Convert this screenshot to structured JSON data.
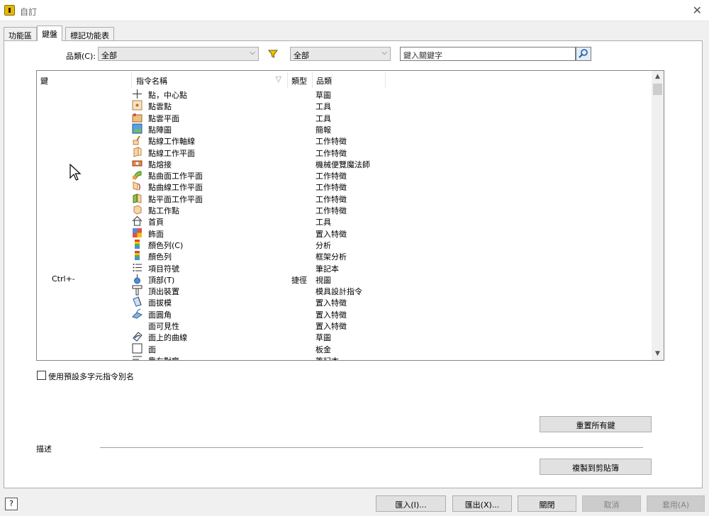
{
  "window": {
    "title": "自訂"
  },
  "tabs": [
    {
      "label": "功能區"
    },
    {
      "label": "鍵盤"
    },
    {
      "label": "標記功能表"
    }
  ],
  "filter": {
    "category_label": "品類(C):",
    "category_value": "全部",
    "type_value": "全部",
    "search_placeholder": "鍵入關鍵字"
  },
  "grid": {
    "headers": {
      "key": "鍵",
      "name": "指令名稱",
      "type": "類型",
      "category": "品類"
    },
    "rows": [
      {
        "key": "",
        "name": "點，中心點",
        "type": "",
        "category": "草圖",
        "icon": "center-point-icon"
      },
      {
        "key": "",
        "name": "點雲點",
        "type": "",
        "category": "工具",
        "icon": "point-cloud-point-icon"
      },
      {
        "key": "",
        "name": "點雲平面",
        "type": "",
        "category": "工具",
        "icon": "point-cloud-plane-icon"
      },
      {
        "key": "",
        "name": "點陣圖",
        "type": "",
        "category": "簡報",
        "icon": "bitmap-icon"
      },
      {
        "key": "",
        "name": "點線工作軸線",
        "type": "",
        "category": "工作特徵",
        "icon": "work-axis-icon"
      },
      {
        "key": "",
        "name": "點線工作平面",
        "type": "",
        "category": "工作特徵",
        "icon": "work-plane-icon"
      },
      {
        "key": "",
        "name": "點熔接",
        "type": "",
        "category": "機械便覽魔法師",
        "icon": "spot-weld-icon"
      },
      {
        "key": "",
        "name": "點曲面工作平面",
        "type": "",
        "category": "工作特徵",
        "icon": "surface-work-plane-icon"
      },
      {
        "key": "",
        "name": "點曲線工作平面",
        "type": "",
        "category": "工作特徵",
        "icon": "curve-work-plane-icon"
      },
      {
        "key": "",
        "name": "點平面工作平面",
        "type": "",
        "category": "工作特徵",
        "icon": "plane-work-plane-icon"
      },
      {
        "key": "",
        "name": "點工作點",
        "type": "",
        "category": "工作特徵",
        "icon": "work-point-icon"
      },
      {
        "key": "",
        "name": "首頁",
        "type": "",
        "category": "工具",
        "icon": "home-icon"
      },
      {
        "key": "",
        "name": "飾面",
        "type": "",
        "category": "置入特徵",
        "icon": "finish-icon"
      },
      {
        "key": "",
        "name": "顏色列(C)",
        "type": "",
        "category": "分析",
        "icon": "color-bar-icon"
      },
      {
        "key": "",
        "name": "顏色列",
        "type": "",
        "category": "框架分析",
        "icon": "color-bar-icon"
      },
      {
        "key": "",
        "name": "項目符號",
        "type": "",
        "category": "筆記本",
        "icon": "bullets-icon"
      },
      {
        "key": "Ctrl+-",
        "name": "頂部(T)",
        "type": "捷徑",
        "category": "視圖",
        "icon": "top-view-icon"
      },
      {
        "key": "",
        "name": "頂出裝置",
        "type": "",
        "category": "模具設計指令",
        "icon": "ejector-icon"
      },
      {
        "key": "",
        "name": "面拔模",
        "type": "",
        "category": "置入特徵",
        "icon": "face-draft-icon"
      },
      {
        "key": "",
        "name": "面圓角",
        "type": "",
        "category": "置入特徵",
        "icon": "face-fillet-icon"
      },
      {
        "key": "",
        "name": "面可見性",
        "type": "",
        "category": "置入特徵",
        "icon": ""
      },
      {
        "key": "",
        "name": "面上的曲線",
        "type": "",
        "category": "草圖",
        "icon": "curve-on-face-icon"
      },
      {
        "key": "",
        "name": "面",
        "type": "",
        "category": "板金",
        "icon": "face-icon"
      },
      {
        "key": "",
        "name": "靠左對齊",
        "type": "",
        "category": "筆記本",
        "icon": "align-left-icon"
      }
    ]
  },
  "options": {
    "multi_char_alias_label": "使用預設多字元指令別名"
  },
  "buttons": {
    "reset_all": "重置所有鍵",
    "copy_clipboard": "複製到剪貼簿",
    "import": "匯入(I)...",
    "export": "匯出(X)...",
    "close": "關閉",
    "cancel": "取消",
    "apply": "套用(A)"
  },
  "description": {
    "label": "描述"
  },
  "colors": {
    "accent": "#1e6fd9",
    "filter": "#e6b800"
  }
}
